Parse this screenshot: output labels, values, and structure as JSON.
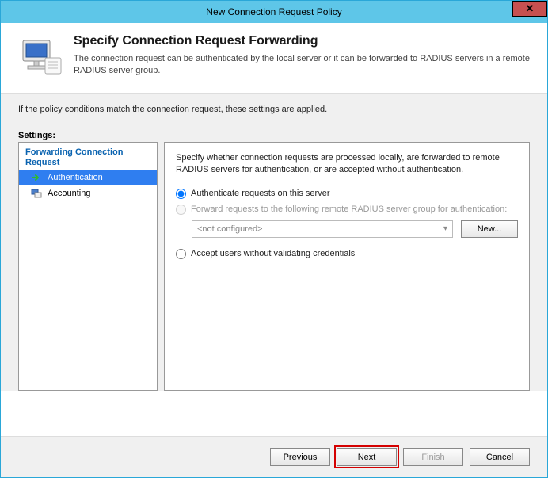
{
  "window": {
    "title": "New Connection Request Policy",
    "close_glyph": "✕"
  },
  "header": {
    "title": "Specify Connection Request Forwarding",
    "subtitle": "The connection request can be authenticated by the local server or it can be forwarded to RADIUS servers in a remote RADIUS server group."
  },
  "conditions_text": "If the policy conditions match the connection request, these settings are applied.",
  "settings_label": "Settings:",
  "tree": {
    "group_label": "Forwarding Connection Request",
    "item_auth": "Authentication",
    "item_acct": "Accounting"
  },
  "panel": {
    "description": "Specify whether connection requests are processed locally, are forwarded to remote RADIUS servers for authentication, or are accepted without authentication.",
    "radio_local": "Authenticate requests on this server",
    "radio_forward": "Forward requests to the following remote RADIUS server group for authentication:",
    "combo_placeholder": "<not configured>",
    "new_button": "New...",
    "radio_accept": "Accept users without validating credentials"
  },
  "footer": {
    "previous": "Previous",
    "next": "Next",
    "finish": "Finish",
    "cancel": "Cancel"
  }
}
